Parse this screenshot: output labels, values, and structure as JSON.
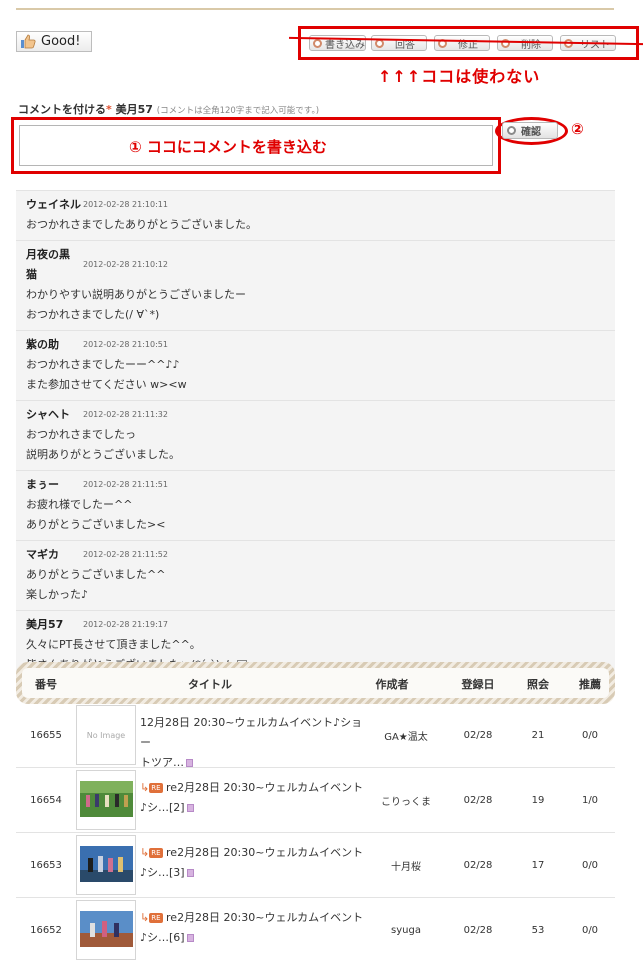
{
  "good_button": {
    "label": "Good!"
  },
  "actions": {
    "write": "書き込み",
    "reply": "回答",
    "edit": "修正",
    "delete": "削除",
    "list": "リスト"
  },
  "annotations": {
    "not_used": "↑↑↑ココは使わない",
    "write_here": "① ココにコメントを書き込む",
    "step_two": "②"
  },
  "comment_form": {
    "label": "コメントを付ける",
    "required_mark": "*",
    "user": "美月57",
    "limit_note": "(コメントは全角120字まで記入可能です。)",
    "confirm_label": "確認"
  },
  "comments": [
    {
      "name": "ウェイネル",
      "date": "2012-02-28 21:10:11",
      "lines": [
        "おつかれさまでしたありがとうございました。"
      ]
    },
    {
      "name": "月夜の黒",
      "name2": "猫",
      "date": "2012-02-28 21:10:12",
      "lines": [
        "わかりやすい説明ありがとうございましたー",
        "おつかれさまでした(/ ∀`*)"
      ]
    },
    {
      "name": "紫の助",
      "date": "2012-02-28 21:10:51",
      "lines": [
        "おつかれさまでしたーー^^♪♪",
        "また参加させてください w><w"
      ]
    },
    {
      "name": "シャヘト",
      "date": "2012-02-28 21:11:32",
      "lines": [
        "おつかれさまでしたっ",
        "説明ありがとうございました。"
      ]
    },
    {
      "name": "まぅー",
      "date": "2012-02-28 21:11:51",
      "lines": [
        "お疲れ様でしたー^^",
        "ありがとうございました><"
      ]
    },
    {
      "name": "マギカ",
      "date": "2012-02-28 21:11:52",
      "lines": [
        "ありがとうございました^^",
        "楽しかった♪"
      ]
    },
    {
      "name": "美月57",
      "date": "2012-02-28 21:19:17",
      "lines": [
        "久々にPT長させて頂きました^^。",
        "皆さんありがとうございましたぃ(*´-`)ノ"
      ]
    }
  ],
  "board": {
    "headers": {
      "number": "番号",
      "title": "タイトル",
      "author": "作成者",
      "date": "登録日",
      "views": "照会",
      "recommend": "推薦"
    },
    "rows": [
      {
        "number": "16655",
        "thumb": "No Image",
        "re": "",
        "title1": "12月28日 20:30~ウェルカムイベント♪ショー",
        "title2": "トツア…",
        "author": "GA★温太",
        "date": "02/28",
        "views": "21",
        "rec": "0/0"
      },
      {
        "number": "16654",
        "thumb": "",
        "re": "RE",
        "title1": "re2月28日 20:30~ウェルカムイベント",
        "title2": "♪シ…[2]",
        "author": "こりっくま",
        "date": "02/28",
        "views": "19",
        "rec": "1/0"
      },
      {
        "number": "16653",
        "thumb": "",
        "re": "RE",
        "title1": "re2月28日 20:30~ウェルカムイベント",
        "title2": "♪シ…[3]",
        "author": "十月桜",
        "date": "02/28",
        "views": "17",
        "rec": "0/0"
      },
      {
        "number": "16652",
        "thumb": "",
        "re": "RE",
        "title1": "re2月28日 20:30~ウェルカムイベント",
        "title2": "♪シ…[6]",
        "author": "syuga",
        "date": "02/28",
        "views": "53",
        "rec": "0/0"
      }
    ]
  },
  "colors": {
    "annotation_red": "#e00000",
    "re_badge": "#e0703a"
  }
}
